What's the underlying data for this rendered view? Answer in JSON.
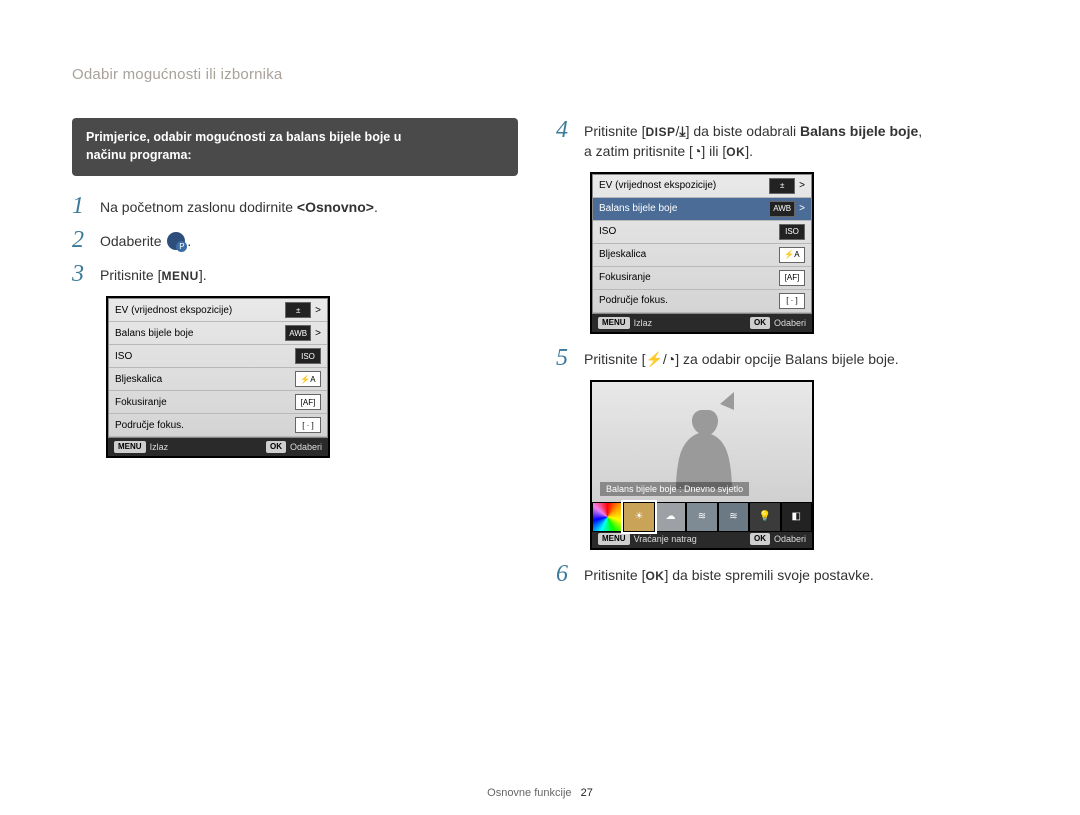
{
  "header": {
    "title": "Odabir mogućnosti ili izbornika"
  },
  "callout": {
    "prefix": "Primjerice, odabir mogućnosti za balans bijele boje u",
    "line2": "načinu programa:"
  },
  "left_steps": {
    "1": {
      "num": "1",
      "text_before": "Na početnom zaslonu dodirnite ",
      "bold": "<Osnovno>",
      "text_after": "."
    },
    "2": {
      "num": "2",
      "text_before": "Odaberite ",
      "text_after": "."
    },
    "3": {
      "num": "3",
      "text_before": "Pritisnite [",
      "btn": "MENU",
      "text_after": "]."
    }
  },
  "screenshot_left": {
    "items": [
      {
        "label": "EV (vrijednost ekspozicije)",
        "value": "±",
        "caret": ">"
      },
      {
        "label": "Balans bijele boje",
        "value": "AWB",
        "caret": ">"
      },
      {
        "label": "ISO",
        "value": "ISO",
        "caret": ""
      },
      {
        "label": "Bljeskalica",
        "value": "⚡A",
        "caret": ""
      },
      {
        "label": "Fokusiranje",
        "value": "[AF]",
        "caret": ""
      },
      {
        "label": "Područje fokus.",
        "value": "[ · ]",
        "caret": ""
      }
    ],
    "footer": {
      "left_chip": "MENU",
      "left_label": "Izlaz",
      "right_chip": "OK",
      "right_label": "Odaberi"
    }
  },
  "right_steps": {
    "4": {
      "num": "4",
      "a1": "Pritisnite [",
      "disp": "DISP",
      "slash": "/",
      "down_icon": "⤓",
      "a2": "] da biste odabrali ",
      "bold": "Balans bijele boje",
      "a3": ",",
      "b1": "a zatim pritisnite [",
      "timer_icon": "◔",
      "b2": "] ili [",
      "ok": "OK",
      "b3": "]."
    },
    "5": {
      "num": "5",
      "t1": "Pritisnite [",
      "flash_icon": "⚡",
      "slash": "/",
      "timer_icon": "◔",
      "t2": "] za odabir opcije Balans bijele boje."
    },
    "6": {
      "num": "6",
      "t1": "Pritisnite [",
      "ok": "OK",
      "t2": "] da biste spremili svoje postavke."
    }
  },
  "screenshot_right_menu": {
    "items": [
      {
        "label": "EV (vrijednost ekspozicije)",
        "value": "±",
        "caret": ">",
        "selected": false
      },
      {
        "label": "Balans bijele boje",
        "value": "AWB",
        "caret": ">",
        "selected": true
      },
      {
        "label": "ISO",
        "value": "ISO",
        "caret": "",
        "selected": false
      },
      {
        "label": "Bljeskalica",
        "value": "⚡A",
        "caret": "",
        "selected": false
      },
      {
        "label": "Fokusiranje",
        "value": "[AF]",
        "caret": "",
        "selected": false
      },
      {
        "label": "Područje fokus.",
        "value": "[ · ]",
        "caret": "",
        "selected": false
      }
    ],
    "footer": {
      "left_chip": "MENU",
      "left_label": "Izlaz",
      "right_chip": "OK",
      "right_label": "Odaberi"
    }
  },
  "wb_shot": {
    "caption": "Balans bijele boje : Dnevno svjetlo",
    "swatches": [
      {
        "name": "Auto",
        "bg": "conic-gradient(red,orange,yellow,lime,cyan,blue,violet,red)",
        "glyph": ""
      },
      {
        "name": "Daylight",
        "bg": "#c9a357",
        "glyph": "☀",
        "selected": true
      },
      {
        "name": "Cloudy",
        "bg": "#9da0a4",
        "glyph": "☁"
      },
      {
        "name": "Fluorescent H",
        "bg": "#7e8b94",
        "glyph": "≋"
      },
      {
        "name": "Fluorescent L",
        "bg": "#6a7983",
        "glyph": "≋"
      },
      {
        "name": "Tungsten",
        "bg": "#3b3b3b",
        "glyph": "💡"
      },
      {
        "name": "Custom",
        "bg": "#222222",
        "glyph": "◧"
      }
    ],
    "footer": {
      "left_chip": "MENU",
      "left_label": "Vraćanje natrag",
      "right_chip": "OK",
      "right_label": "Odaberi"
    }
  },
  "footer": {
    "section": "Osnovne funkcije",
    "page": "27"
  }
}
